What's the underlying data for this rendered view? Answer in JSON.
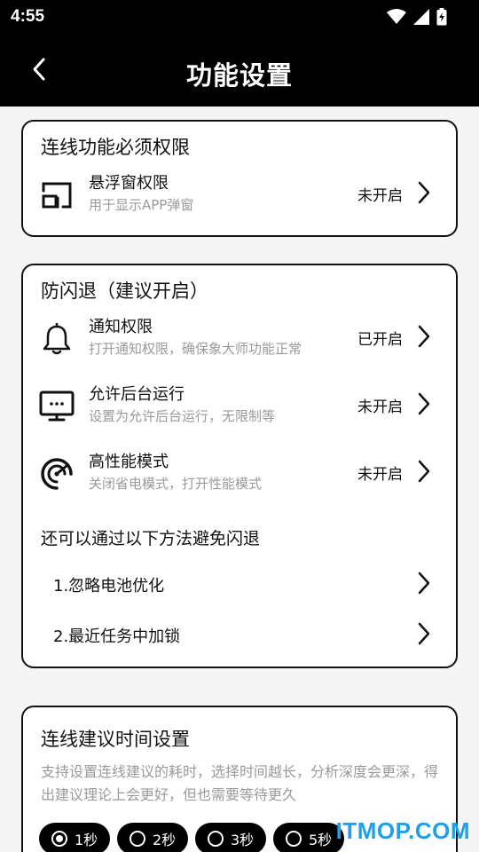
{
  "status": {
    "time": "4:55"
  },
  "appbar": {
    "title": "功能设置"
  },
  "card1": {
    "title": "连线功能必须权限",
    "item": {
      "label": "悬浮窗权限",
      "desc": "用于显示APP弹窗",
      "state": "未开启",
      "icon": "floating-window-icon"
    }
  },
  "card2": {
    "title": "防闪退（建议开启）",
    "items": [
      {
        "label": "通知权限",
        "desc": "打开通知权限，确保象大师功能正常",
        "state": "已开启",
        "icon": "bell-icon"
      },
      {
        "label": "允许后台运行",
        "desc": "设置为允许后台运行，无限制等",
        "state": "未开启",
        "icon": "monitor-icon"
      },
      {
        "label": "高性能模式",
        "desc": "关闭省电模式，打开性能模式",
        "state": "未开启",
        "icon": "speedometer-icon"
      }
    ],
    "tips_title": "还可以通过以下方法避免闪退",
    "tips": [
      {
        "label": "1.忽略电池优化"
      },
      {
        "label": "2.最近任务中加锁"
      }
    ]
  },
  "card3": {
    "title": "连线建议时间设置",
    "desc": "支持设置连线建议的耗时，选择时间越长，分析深度会更深，得出建议理论上会更好，但也需要等待更久",
    "options": [
      {
        "label": "1秒",
        "selected": true
      },
      {
        "label": "2秒",
        "selected": false
      },
      {
        "label": "3秒",
        "selected": false
      },
      {
        "label": "5秒",
        "selected": false
      }
    ]
  },
  "watermark": "ITMOP.COM"
}
